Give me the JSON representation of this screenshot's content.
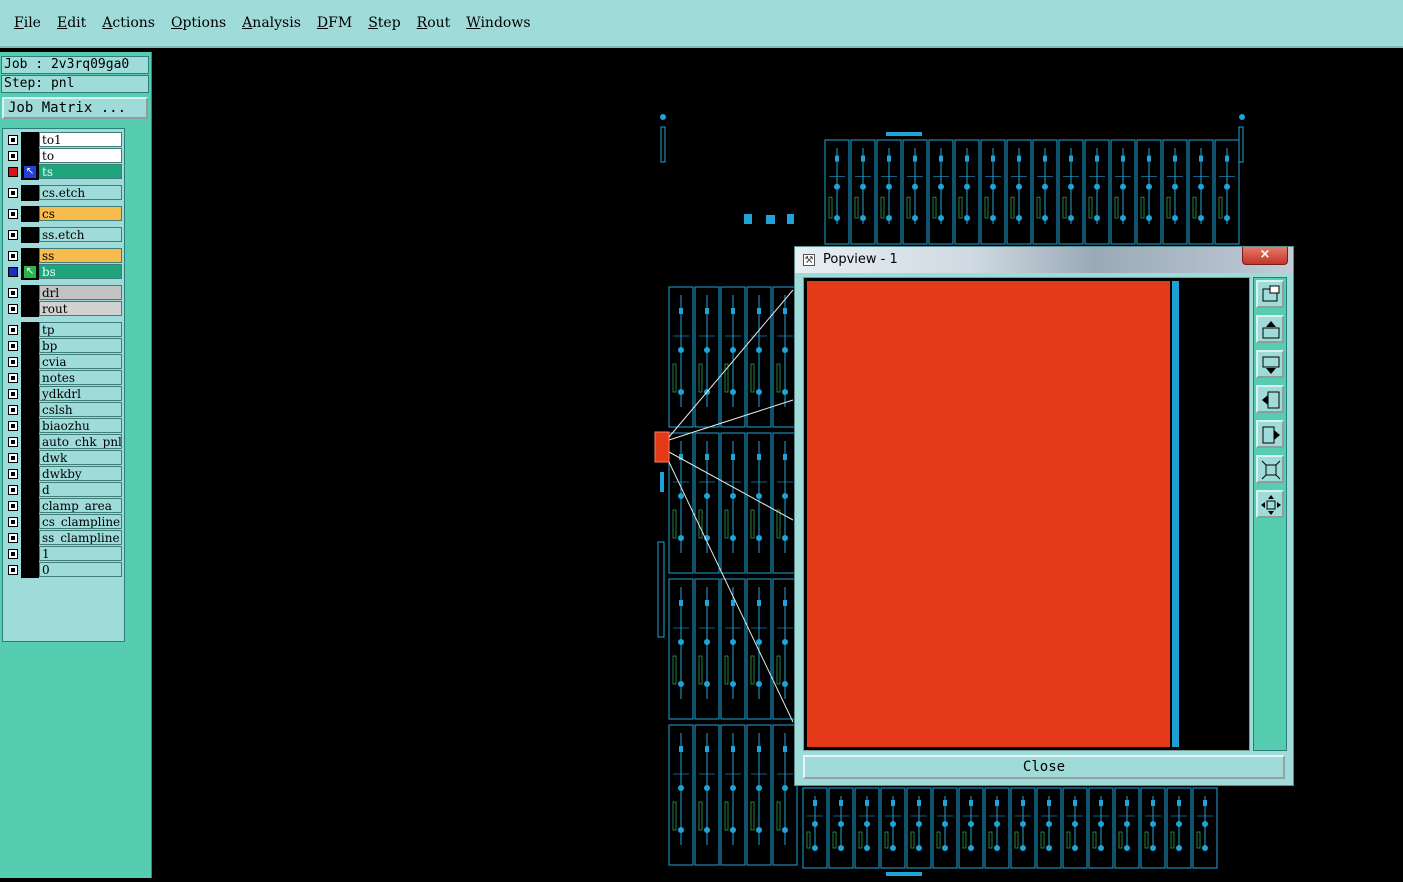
{
  "menu": [
    {
      "id": "file",
      "first": "F",
      "rest": "ile"
    },
    {
      "id": "edit",
      "first": "E",
      "rest": "dit"
    },
    {
      "id": "actions",
      "first": "A",
      "rest": "ctions"
    },
    {
      "id": "options",
      "first": "O",
      "rest": "ptions"
    },
    {
      "id": "analysis",
      "first": "A",
      "rest": "nalysis"
    },
    {
      "id": "dfm",
      "first": "D",
      "rest": "FM"
    },
    {
      "id": "step",
      "first": "S",
      "rest": "tep"
    },
    {
      "id": "rout",
      "first": "R",
      "rest": "out"
    },
    {
      "id": "windows",
      "first": "W",
      "rest": "indows"
    }
  ],
  "job": {
    "label": "Job : 2v3rq09ga0"
  },
  "step": {
    "label": "Step: pnl"
  },
  "job_matrix": {
    "label": "Job Matrix ..."
  },
  "layers": [
    {
      "name": "to1",
      "color": "white"
    },
    {
      "name": "to",
      "color": "white"
    },
    {
      "name": "ts",
      "color": "green",
      "state": "red",
      "pointer": "blue"
    },
    {
      "name": "cs.etch",
      "color": "teal"
    },
    {
      "name": "cs",
      "color": "orange"
    },
    {
      "name": "ss.etch",
      "color": "teal"
    },
    {
      "name": "ss",
      "color": "orange"
    },
    {
      "name": "bs",
      "color": "green",
      "state": "blue",
      "pointer": "green"
    },
    {
      "name": "drl",
      "color": "gray"
    },
    {
      "name": "rout",
      "color": "lgray"
    },
    {
      "name": "tp",
      "color": "teal"
    },
    {
      "name": "bp",
      "color": "teal"
    },
    {
      "name": "cvia",
      "color": "teal"
    },
    {
      "name": "notes",
      "color": "teal"
    },
    {
      "name": "ydkdrl",
      "color": "teal"
    },
    {
      "name": "cslsh",
      "color": "teal"
    },
    {
      "name": "biaozhu",
      "color": "teal"
    },
    {
      "name": "auto_chk_pnl",
      "color": "teal"
    },
    {
      "name": "dwk",
      "color": "teal"
    },
    {
      "name": "dwkby",
      "color": "teal"
    },
    {
      "name": "d",
      "color": "teal"
    },
    {
      "name": "clamp_area",
      "color": "teal"
    },
    {
      "name": "cs_clampline",
      "color": "teal"
    },
    {
      "name": "ss_clampline",
      "color": "teal"
    },
    {
      "name": "1",
      "color": "teal"
    },
    {
      "name": "0",
      "color": "teal"
    }
  ],
  "popview": {
    "title": "Popview - 1",
    "close_x": "×",
    "close_label": "Close",
    "tools": [
      "zoom-window-icon",
      "pan-up-icon",
      "pan-down-icon",
      "pan-left-icon",
      "pan-right-icon",
      "zoom-fit-icon",
      "zoom-center-icon"
    ]
  },
  "colors": {
    "panel": "#56cdb0",
    "menubar": "#9fdbd9",
    "pcb_line": "#1fa3d8",
    "highlight": "#e43a18"
  }
}
